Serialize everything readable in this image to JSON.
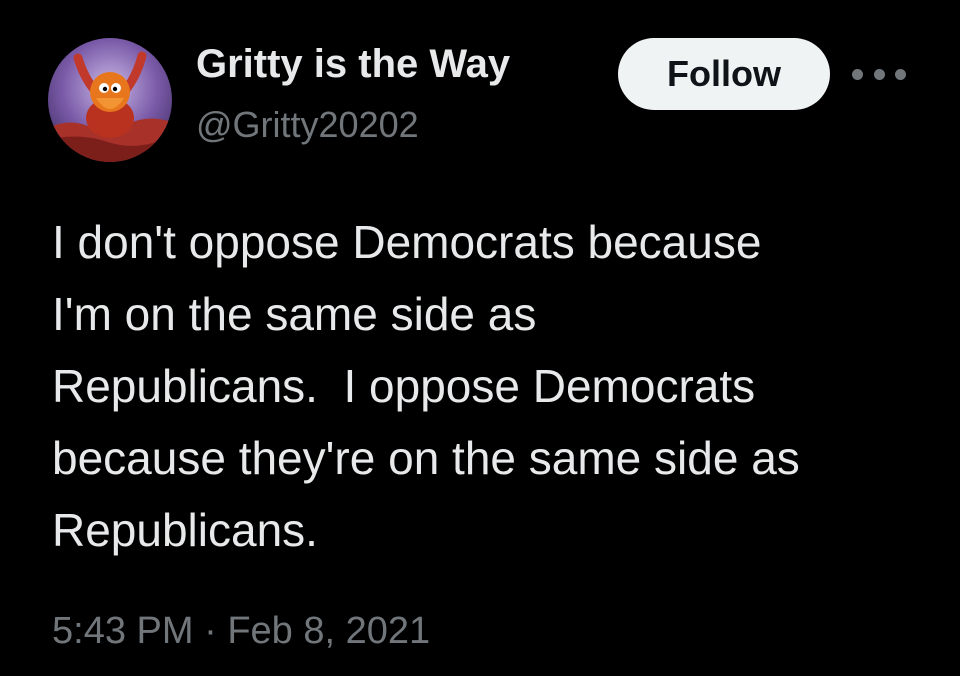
{
  "author": {
    "display_name": "Gritty is the Way",
    "handle": "@Gritty20202"
  },
  "actions": {
    "follow_label": "Follow",
    "more_icon": "more-horizontal-icon"
  },
  "tweet": {
    "text": "I don't oppose Democrats because\nI'm on the same side as\nRepublicans.  I oppose Democrats\nbecause they're on the same side as\nRepublicans.",
    "time": "5:43 PM",
    "separator": "·",
    "date": "Feb 8, 2021"
  },
  "colors": {
    "background": "#000000",
    "primary_text": "#e7e9ea",
    "secondary_text": "#71767b",
    "follow_bg": "#eff3f4",
    "follow_text": "#0f1419"
  }
}
